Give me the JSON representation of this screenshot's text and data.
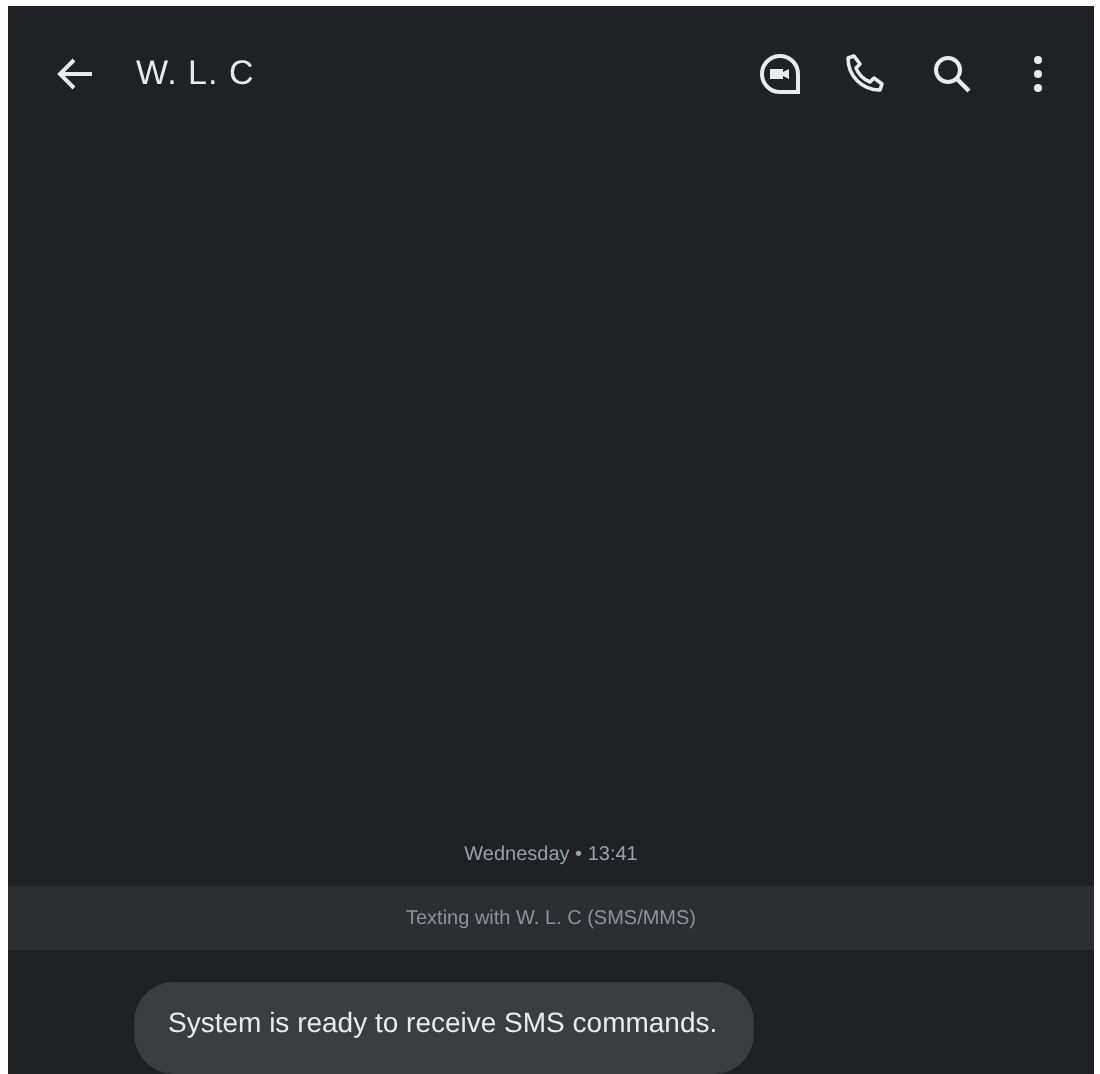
{
  "header": {
    "title": "W. L. C"
  },
  "timestamp": "Wednesday • 13:41",
  "banner": "Texting with W. L. C (SMS/MMS)",
  "messages": [
    {
      "text": "System is ready to receive SMS commands."
    }
  ]
}
